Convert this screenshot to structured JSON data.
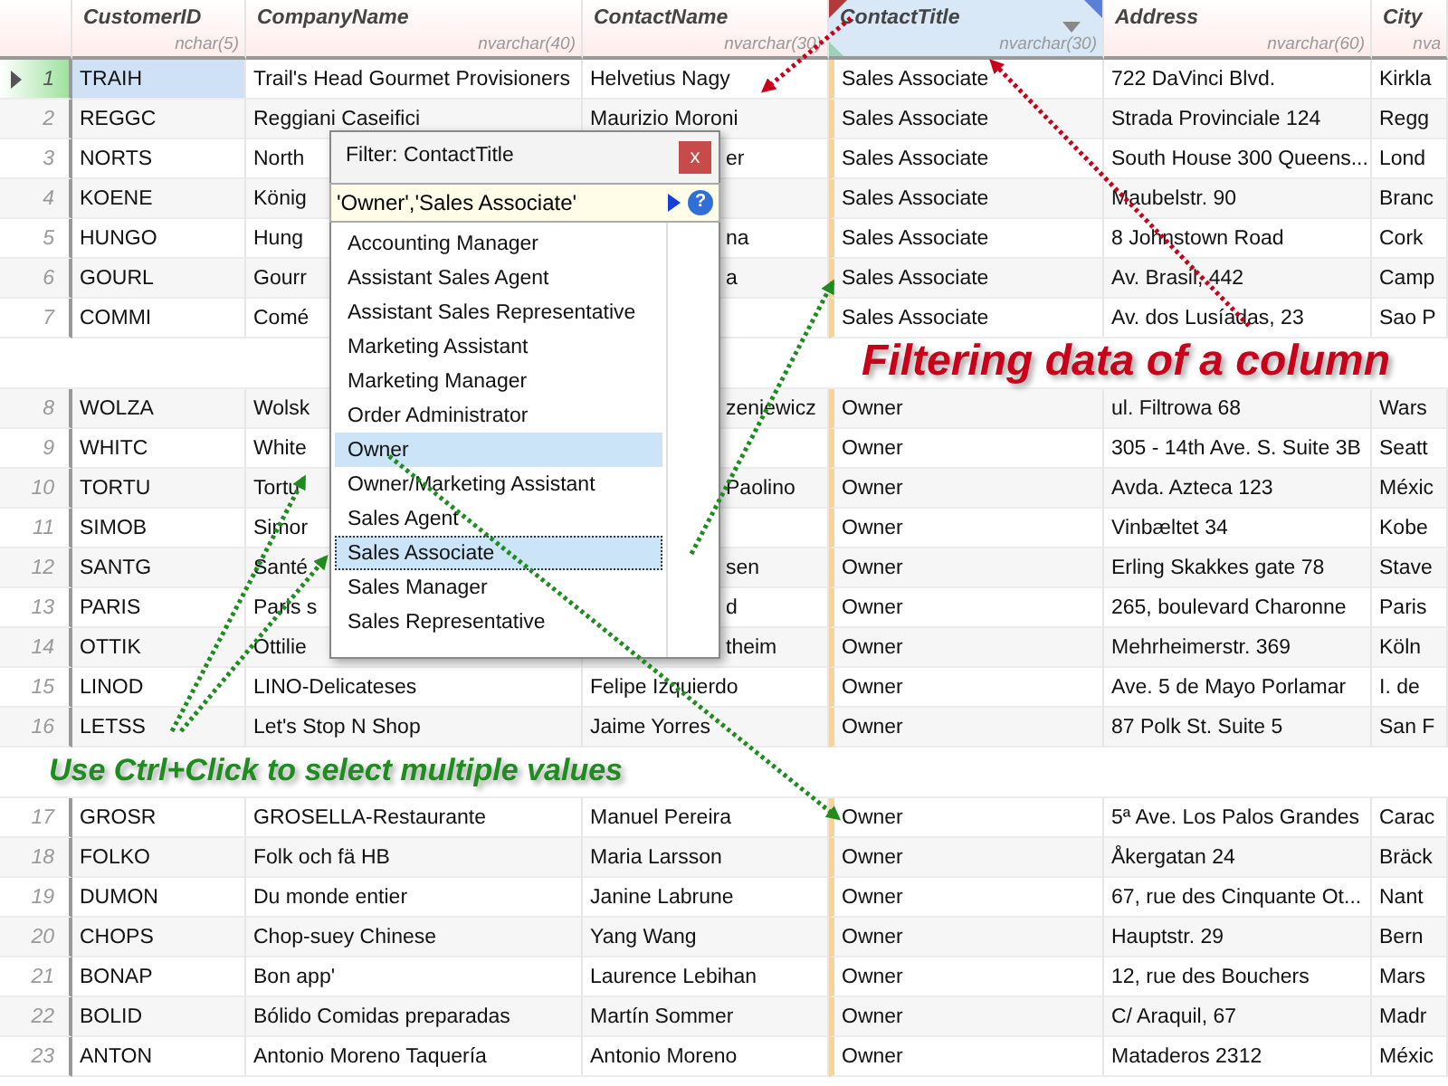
{
  "grid": {
    "columns": [
      {
        "name": "CustomerID",
        "type": "nchar(5)",
        "filtered": false
      },
      {
        "name": "CompanyName",
        "type": "nvarchar(40)",
        "filtered": false
      },
      {
        "name": "ContactName",
        "type": "nvarchar(30)",
        "filtered": false
      },
      {
        "name": "ContactTitle",
        "type": "nvarchar(30)",
        "filtered": true
      },
      {
        "name": "Address",
        "type": "nvarchar(60)",
        "filtered": false
      },
      {
        "name": "City",
        "type": "nva",
        "filtered": false
      }
    ],
    "rows": [
      {
        "number": "1",
        "selected": true,
        "cells": [
          "TRAIH",
          "Trail's Head Gourmet Provisioners",
          "Helvetius Nagy",
          "Sales Associate",
          "722 DaVinci Blvd.",
          "Kirkla"
        ]
      },
      {
        "number": "2",
        "selected": false,
        "cells": [
          "REGGC",
          "Reggiani Caseifici",
          "Maurizio Moroni",
          "Sales Associate",
          "Strada Provinciale 124",
          "Regg"
        ]
      },
      {
        "number": "3",
        "selected": false,
        "cells": [
          "NORTS",
          "North",
          "er",
          "Sales Associate",
          "South House 300 Queens...",
          "Lond"
        ]
      },
      {
        "number": "4",
        "selected": false,
        "cells": [
          "KOENE",
          "König",
          null,
          "Sales Associate",
          "Maubelstr. 90",
          "Branc"
        ]
      },
      {
        "number": "5",
        "selected": false,
        "cells": [
          "HUNGO",
          "Hung",
          "na",
          "Sales Associate",
          "8 Johnstown Road",
          "Cork"
        ]
      },
      {
        "number": "6",
        "selected": false,
        "cells": [
          "GOURL",
          "Gourr",
          "a",
          "Sales Associate",
          "Av. Brasil, 442",
          "Camp"
        ]
      },
      {
        "number": "7",
        "selected": false,
        "cells": [
          "COMMI",
          "Comé",
          null,
          "Sales Associate",
          "Av. dos Lusíadas, 23",
          "Sao P"
        ]
      },
      {
        "number": "8",
        "selected": false,
        "cells": [
          "WOLZA",
          "Wolsk",
          "zeniewicz",
          "Owner",
          "ul. Filtrowa 68",
          "Wars"
        ]
      },
      {
        "number": "9",
        "selected": false,
        "cells": [
          "WHITC",
          "White",
          null,
          "Owner",
          "305 - 14th Ave. S. Suite 3B",
          "Seatt"
        ]
      },
      {
        "number": "10",
        "selected": false,
        "cells": [
          "TORTU",
          "Tortu",
          "Paolino",
          "Owner",
          "Avda. Azteca 123",
          "Méxic"
        ]
      },
      {
        "number": "11",
        "selected": false,
        "cells": [
          "SIMOB",
          "Simor",
          null,
          "Owner",
          "Vinbæltet 34",
          "Kobe"
        ]
      },
      {
        "number": "12",
        "selected": false,
        "cells": [
          "SANTG",
          "Santé",
          "sen",
          "Owner",
          "Erling Skakkes gate 78",
          "Stave"
        ]
      },
      {
        "number": "13",
        "selected": false,
        "cells": [
          "PARIS",
          "Paris s",
          "d",
          "Owner",
          "265, boulevard Charonne",
          "Paris"
        ]
      },
      {
        "number": "14",
        "selected": false,
        "cells": [
          "OTTIK",
          "Ottilie",
          "theim",
          "Owner",
          "Mehrheimerstr. 369",
          "Köln"
        ]
      },
      {
        "number": "15",
        "selected": false,
        "cells": [
          "LINOD",
          "LINO-Delicateses",
          "Felipe Izquierdo",
          "Owner",
          "Ave. 5 de Mayo Porlamar",
          "I. de"
        ]
      },
      {
        "number": "16",
        "selected": false,
        "cells": [
          "LETSS",
          "Let's Stop N Shop",
          "Jaime Yorres",
          "Owner",
          "87 Polk St. Suite 5",
          "San F"
        ]
      },
      {
        "number": "17",
        "selected": false,
        "cells": [
          "GROSR",
          "GROSELLA-Restaurante",
          "Manuel Pereira",
          "Owner",
          "5ª Ave. Los Palos Grandes",
          "Carac"
        ]
      },
      {
        "number": "18",
        "selected": false,
        "cells": [
          "FOLKO",
          "Folk och fä HB",
          "Maria Larsson",
          "Owner",
          "Åkergatan 24",
          "Bräck"
        ]
      },
      {
        "number": "19",
        "selected": false,
        "cells": [
          "DUMON",
          "Du monde entier",
          "Janine Labrune",
          "Owner",
          "67, rue des Cinquante Ot...",
          "Nant"
        ]
      },
      {
        "number": "20",
        "selected": false,
        "cells": [
          "CHOPS",
          "Chop-suey Chinese",
          "Yang Wang",
          "Owner",
          "Hauptstr. 29",
          "Bern"
        ]
      },
      {
        "number": "21",
        "selected": false,
        "cells": [
          "BONAP",
          "Bon app'",
          "Laurence Lebihan",
          "Owner",
          "12, rue des Bouchers",
          "Mars"
        ]
      },
      {
        "number": "22",
        "selected": false,
        "cells": [
          "BOLID",
          "Bólido Comidas preparadas",
          "Martín Sommer",
          "Owner",
          "C/ Araquil, 67",
          "Madr"
        ]
      },
      {
        "number": "23",
        "selected": false,
        "cells": [
          "ANTON",
          "Antonio Moreno Taquería",
          "Antonio Moreno",
          "Owner",
          "Mataderos  2312",
          "Méxic"
        ]
      }
    ]
  },
  "filter_popup": {
    "title": "Filter: ContactTitle",
    "close": "x",
    "value": "'Owner','Sales Associate'",
    "help": "?",
    "items": [
      {
        "label": "Accounting Manager",
        "selected": false,
        "focused": false
      },
      {
        "label": "Assistant Sales Agent",
        "selected": false,
        "focused": false
      },
      {
        "label": "Assistant Sales Representative",
        "selected": false,
        "focused": false
      },
      {
        "label": "Marketing Assistant",
        "selected": false,
        "focused": false
      },
      {
        "label": "Marketing Manager",
        "selected": false,
        "focused": false
      },
      {
        "label": "Order Administrator",
        "selected": false,
        "focused": false
      },
      {
        "label": "Owner",
        "selected": true,
        "focused": false
      },
      {
        "label": "Owner/Marketing Assistant",
        "selected": false,
        "focused": false
      },
      {
        "label": "Sales Agent",
        "selected": false,
        "focused": false
      },
      {
        "label": "Sales Associate",
        "selected": true,
        "focused": true
      },
      {
        "label": "Sales Manager",
        "selected": false,
        "focused": false
      },
      {
        "label": "Sales Representative",
        "selected": false,
        "focused": false
      }
    ]
  },
  "annotations": [
    {
      "text": "Filtering data of a column",
      "color": "#c8001a"
    },
    {
      "text": "Use Ctrl+Click to select multiple values",
      "color": "#1f8c1f"
    }
  ]
}
